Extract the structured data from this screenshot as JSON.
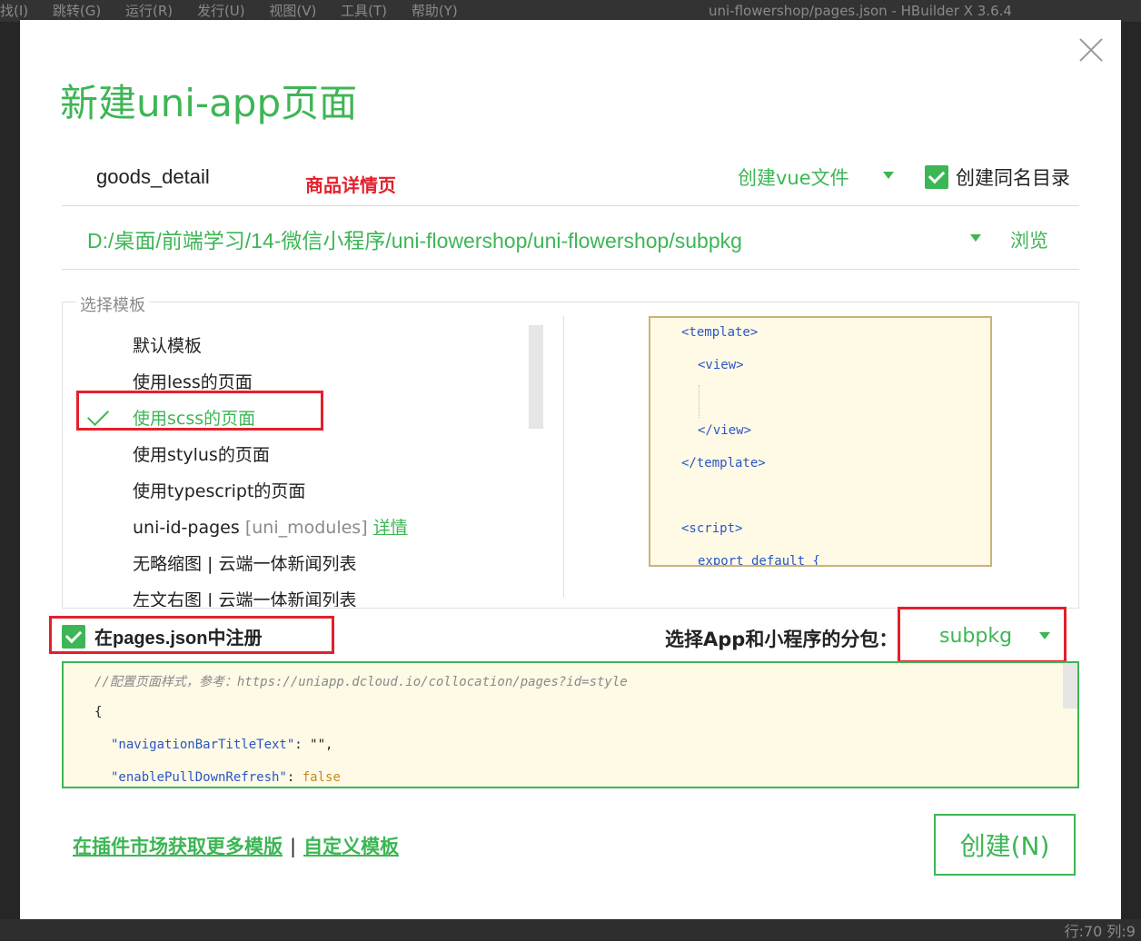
{
  "background": {
    "menu_items": [
      "找(I)",
      "跳转(G)",
      "运行(R)",
      "发行(U)",
      "视图(V)",
      "工具(T)",
      "帮助(Y)"
    ],
    "window_title": "uni-flowershop/pages.json - HBuilder X 3.6.4",
    "status_position": "行:70  列:9"
  },
  "dialog": {
    "title": "新建uni-app页面",
    "page_name_value": "goods_detail",
    "annotation": "商品详情页",
    "file_type": "创建vue文件",
    "create_same_dir_label": "创建同名目录",
    "path": "D:/桌面/前端学习/14-微信小程序/uni-flowershop/uni-flowershop/subpkg",
    "browse_label": "浏览",
    "template_legend": "选择模板",
    "templates": [
      "默认模板",
      "使用less的页面",
      "使用scss的页面",
      "使用stylus的页面",
      "使用typescript的页面",
      "uni-id-pages",
      "无略缩图 | 云端一体新闻列表",
      "左文右图 | 云端一体新闻列表"
    ],
    "template_extra": {
      "modules_tag": "[uni_modules]",
      "detail_link": "详情"
    },
    "preview_lines": [
      "<template>",
      "<view>",
      "</view>",
      "</template>",
      "<script>",
      "export default {"
    ],
    "register_label": "在pages.json中注册",
    "subpkg_label": "选择App和小程序的分包：",
    "subpkg_value": "subpkg",
    "config": {
      "comment": "//配置页面样式，参考：https://uniapp.dcloud.io/collocation/pages?id=style",
      "brace": "{",
      "line1_key": "\"navigationBarTitleText\"",
      "line1_rest": ": \"\",",
      "line2_key": "\"enablePullDownRefresh\"",
      "line2_sep": ": ",
      "line2_value": "false"
    },
    "footer_link1": "在插件市场获取更多模版",
    "footer_sep": "|",
    "footer_link2": "自定义模板",
    "create_button": "创建(N)"
  },
  "colors": {
    "accent": "#3db655",
    "annotation_red": "#e3202c",
    "preview_bg": "#fefae6"
  }
}
